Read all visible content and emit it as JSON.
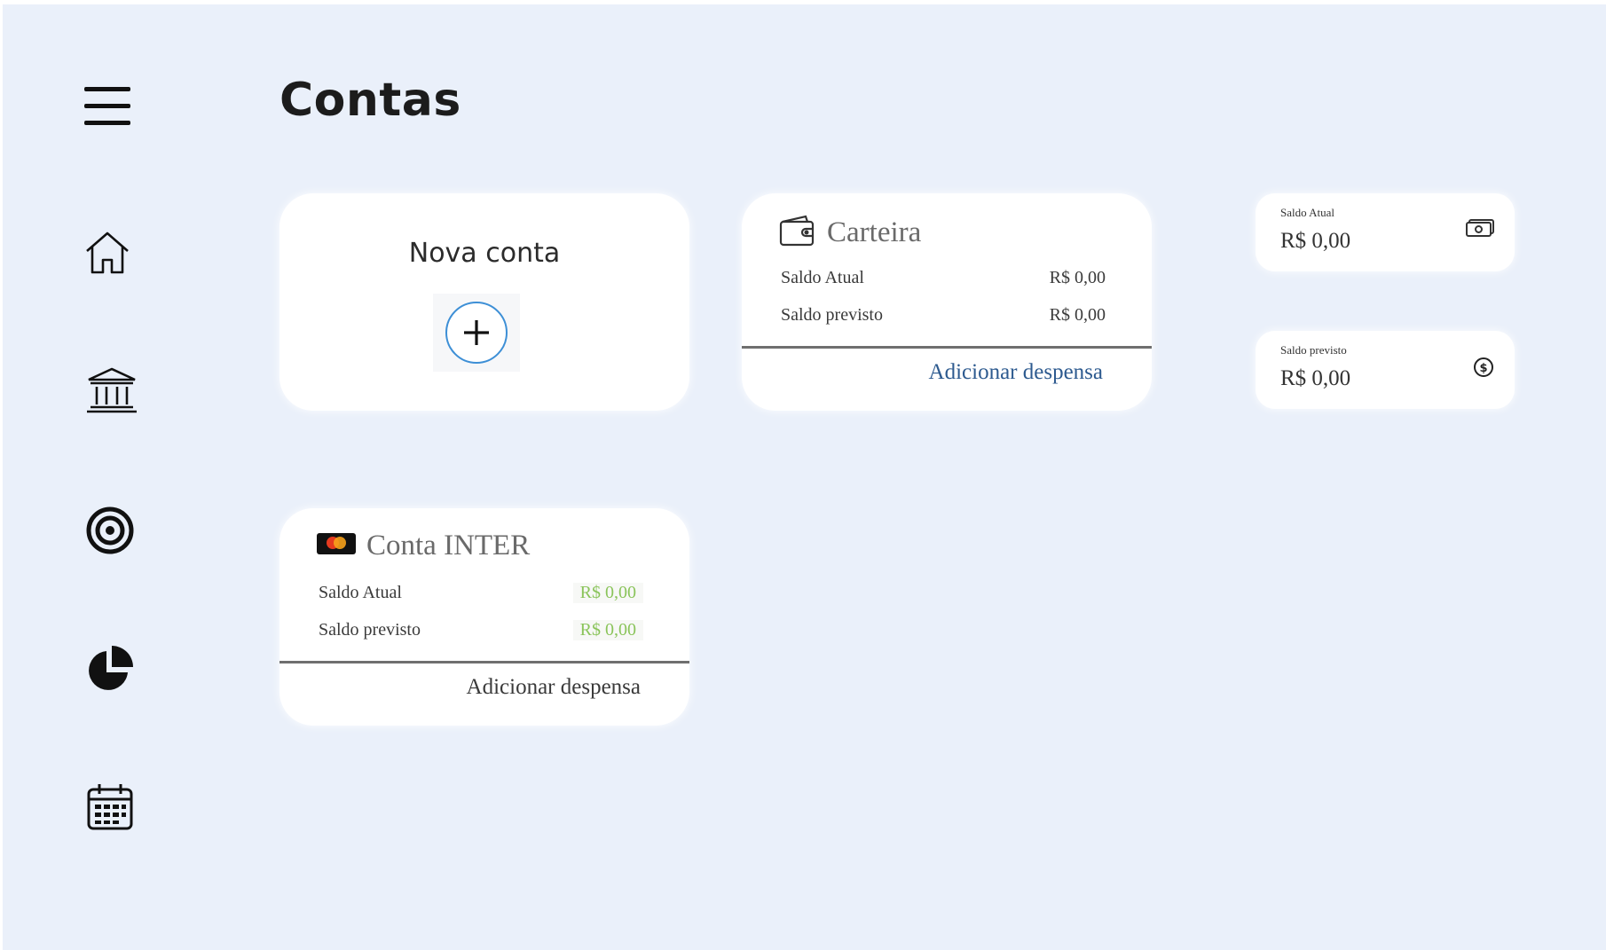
{
  "page": {
    "title": "Contas"
  },
  "sidebar": {
    "items": [
      {
        "icon": "menu-icon"
      },
      {
        "icon": "home-icon"
      },
      {
        "icon": "bank-icon"
      },
      {
        "icon": "target-icon"
      },
      {
        "icon": "pie-chart-icon"
      },
      {
        "icon": "calendar-icon"
      }
    ]
  },
  "new_account": {
    "label": "Nova conta",
    "icon": "plus-icon",
    "accent": "#3d8fd6"
  },
  "accounts": [
    {
      "name": "Carteira",
      "icon": "wallet-icon",
      "saldo_atual_label": "Saldo Atual",
      "saldo_atual_value": "R$ 0,00",
      "saldo_previsto_label": "Saldo previsto",
      "saldo_previsto_value": "R$ 0,00",
      "action": "Adicionar despensa",
      "action_color": "#2d5a8f"
    },
    {
      "name": "Conta INTER",
      "icon": "mastercard-icon",
      "saldo_atual_label": "Saldo Atual",
      "saldo_atual_value": "R$ 0,00",
      "saldo_previsto_label": "Saldo previsto",
      "saldo_previsto_value": "R$ 0,00",
      "value_color": "#8ac45a",
      "action": "Adicionar despensa"
    }
  ],
  "summary": [
    {
      "label": "Saldo Atual",
      "value": "R$ 0,00",
      "icon": "money-bill-icon"
    },
    {
      "label": "Saldo previsto",
      "value": "R$ 0,00",
      "icon": "dollar-circle-icon"
    }
  ],
  "colors": {
    "background": "#eaf0fa",
    "card": "#ffffff"
  }
}
